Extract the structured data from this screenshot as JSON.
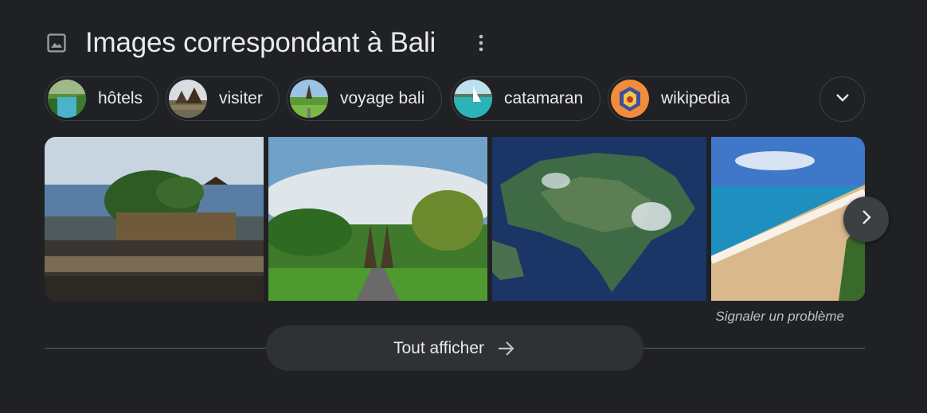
{
  "header": {
    "title": "Images correspondant à Bali",
    "icon": "image-icon",
    "more_icon": "more-vert-icon"
  },
  "chips": [
    {
      "label": "hôtels",
      "thumb": "resort-pool-thumbnail"
    },
    {
      "label": "visiter",
      "thumb": "temple-thumbnail"
    },
    {
      "label": "voyage bali",
      "thumb": "rice-field-thumbnail"
    },
    {
      "label": "catamaran",
      "thumb": "sea-boat-thumbnail"
    },
    {
      "label": "wikipedia",
      "thumb": "emblem-thumbnail"
    }
  ],
  "expand_icon": "chevron-down-icon",
  "images": [
    {
      "alt": "tanah-lot-temple"
    },
    {
      "alt": "bali-gate-garden"
    },
    {
      "alt": "bali-satellite-view"
    },
    {
      "alt": "bali-beach"
    }
  ],
  "next_icon": "chevron-right-icon",
  "report_label": "Signaler un problème",
  "show_all": {
    "label": "Tout afficher",
    "icon": "arrow-right-icon"
  },
  "colors": {
    "background": "#202124",
    "text": "#e8eaed",
    "muted": "#bdc1c6",
    "button": "#303134"
  }
}
